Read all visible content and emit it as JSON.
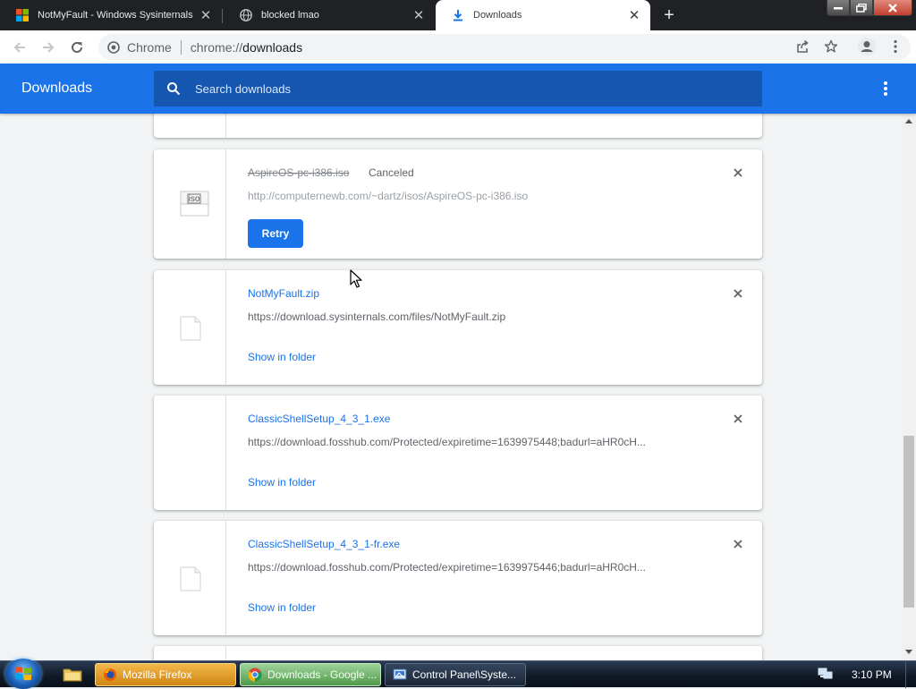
{
  "tabs": [
    {
      "title": "NotMyFault - Windows Sysinternals",
      "icon": "microsoft-logo-icon"
    },
    {
      "title": "blocked lmao",
      "icon": "globe-icon"
    },
    {
      "title": "Downloads",
      "icon": "download-icon"
    }
  ],
  "toolbar": {
    "chip_label": "Chrome",
    "url_scheme": "chrome://",
    "url_host": "downloads"
  },
  "downloads_page": {
    "title": "Downloads",
    "search_placeholder": "Search downloads"
  },
  "downloads": [
    {
      "filename": "AspireOS-pc-i386.iso",
      "status": "Canceled",
      "url": "http://computernewb.com/~dartz/isos/AspireOS-pc-i386.iso",
      "action": "Retry",
      "icon": "iso-file-icon"
    },
    {
      "filename": "NotMyFault.zip",
      "url": "https://download.sysinternals.com/files/NotMyFault.zip",
      "action": "Show in folder",
      "icon": "file-icon"
    },
    {
      "filename": "ClassicShellSetup_4_3_1.exe",
      "url": "https://download.fosshub.com/Protected/expiretime=1639975448;badurl=aHR0cH...",
      "action": "Show in folder",
      "icon": "none"
    },
    {
      "filename": "ClassicShellSetup_4_3_1-fr.exe",
      "url": "https://download.fosshub.com/Protected/expiretime=1639975446;badurl=aHR0cH...",
      "action": "Show in folder",
      "icon": "file-icon"
    }
  ],
  "taskbar": {
    "buttons": [
      {
        "label": "Mozilla Firefox",
        "icon": "firefox-icon"
      },
      {
        "label": "Downloads - Google ...",
        "icon": "chrome-icon"
      },
      {
        "label": "Control Panel\\Syste...",
        "icon": "control-panel-icon"
      }
    ],
    "time": "3:10 PM"
  },
  "colors": {
    "accent": "#1a73e8",
    "header_search": "#1557b0",
    "tabstrip": "#202124"
  }
}
